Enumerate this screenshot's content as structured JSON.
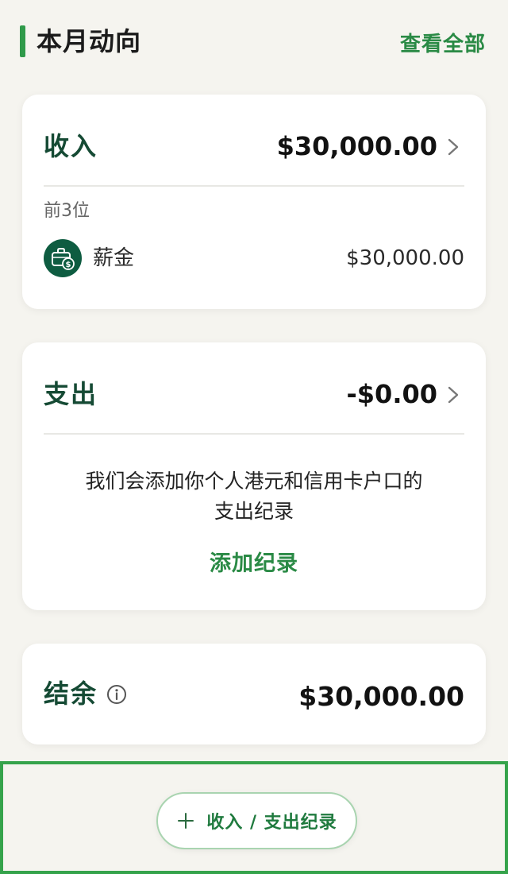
{
  "section": {
    "title": "本月动向",
    "view_all": "查看全部"
  },
  "income": {
    "title": "收入",
    "amount": "$30,000.00",
    "top_label": "前3位",
    "items": [
      {
        "name": "薪金",
        "value": "$30,000.00",
        "icon": "briefcase-dollar-icon"
      }
    ]
  },
  "expense": {
    "title": "支出",
    "amount": "-$0.00",
    "message_line1": "我们会添加你个人港元和信用卡户口的",
    "message_line2": "支出纪录",
    "add_link": "添加纪录"
  },
  "balance": {
    "title": "结余",
    "amount": "$30,000.00"
  },
  "bottom": {
    "record_button": "收入 / 支出纪录"
  },
  "colors": {
    "accent": "#2f9a4a",
    "title_green": "#154a34",
    "icon_bg": "#0e5c41",
    "background": "#f5f4ef"
  }
}
